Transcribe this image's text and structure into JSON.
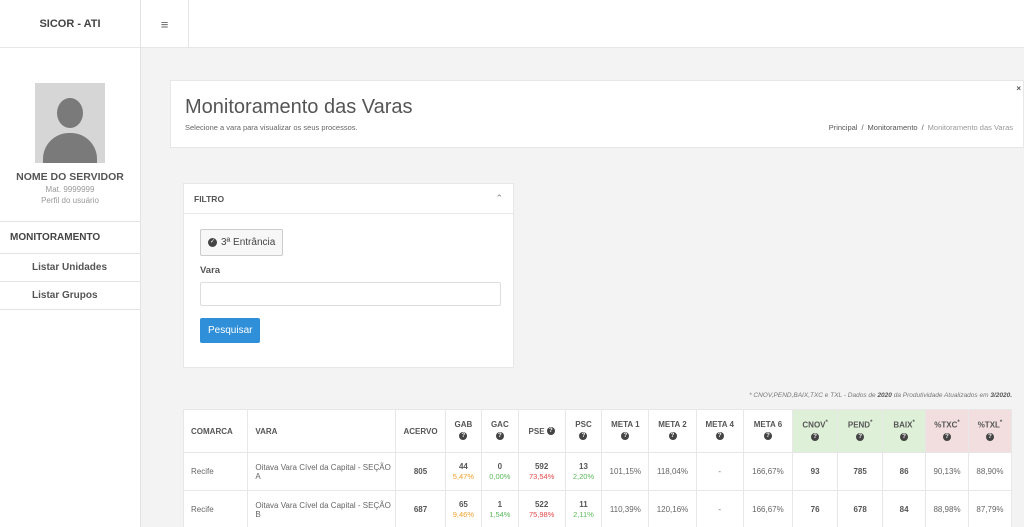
{
  "sidebar": {
    "brand": "SICOR - ATI",
    "profile": {
      "name": "NOME DO SERVIDOR",
      "mat": "Mat. 9999999",
      "role": "Perfil do usuário"
    },
    "section": "MONITORAMENTO",
    "items": [
      {
        "label": "Listar Unidades"
      },
      {
        "label": "Listar Grupos"
      }
    ]
  },
  "topbar": {
    "menu_icon": "≡"
  },
  "header": {
    "title": "Monitoramento das Varas",
    "subtitle": "Selecione a vara para visualizar os seus processos.",
    "breadcrumb": [
      "Principal",
      "Monitoramento",
      "Monitoramento das Varas"
    ],
    "close": "×"
  },
  "filter": {
    "title": "FILTRO",
    "entrancia_button": "3ª Entrância",
    "vara_label": "Vara",
    "vara_value": "",
    "search_button": "Pesquisar"
  },
  "note": {
    "prefix": "* CNOV,PEND,BAIX,TXC e TXL - Dados de ",
    "year": "2020",
    "middle": " da Produtividade Atualizados em ",
    "date": "3/2020."
  },
  "table": {
    "headers": {
      "comarca": "COMARCA",
      "vara": "VARA",
      "acervo": "ACERVO",
      "gab": "GAB",
      "gac": "GAC",
      "pse": "PSE",
      "psc": "PSC",
      "meta1": "META 1",
      "meta2": "META 2",
      "meta4": "META 4",
      "meta6": "META 6",
      "cnov": "CNOV",
      "pend": "PEND",
      "baix": "BAIX",
      "txc": "%TXC",
      "txl": "%TXL",
      "star": "*",
      "q": "?"
    },
    "rows": [
      {
        "comarca": "Recife",
        "vara": "Oitava Vara Cível da Capital - SEÇÃO A",
        "acervo": "805",
        "gab": "44",
        "gab_pct": "5,47%",
        "gac": "0",
        "gac_pct": "0,00%",
        "pse": "592",
        "pse_pct": "73,54%",
        "psc": "13",
        "psc_pct": "2,20%",
        "meta1": "101,15%",
        "meta2": "118,04%",
        "meta4": "-",
        "meta6": "166,67%",
        "cnov": "93",
        "pend": "785",
        "baix": "86",
        "txc": "90,13%",
        "txl": "88,90%"
      },
      {
        "comarca": "Recife",
        "vara": "Oitava Vara Cível da Capital - SEÇÃO B",
        "acervo": "687",
        "gab": "65",
        "gab_pct": "9,46%",
        "gac": "1",
        "gac_pct": "1,54%",
        "pse": "522",
        "pse_pct": "75,98%",
        "psc": "11",
        "psc_pct": "2,11%",
        "meta1": "110,39%",
        "meta2": "120,16%",
        "meta4": "-",
        "meta6": "166,67%",
        "cnov": "76",
        "pend": "678",
        "baix": "84",
        "txc": "88,98%",
        "txl": "87,79%"
      }
    ]
  },
  "colors": {
    "accent": "#2f8fd8",
    "green": "#5cb85c",
    "red": "#e14a4a",
    "orange": "#f0a12c",
    "header_green": "#dff0d8",
    "header_red": "#f2dede"
  }
}
